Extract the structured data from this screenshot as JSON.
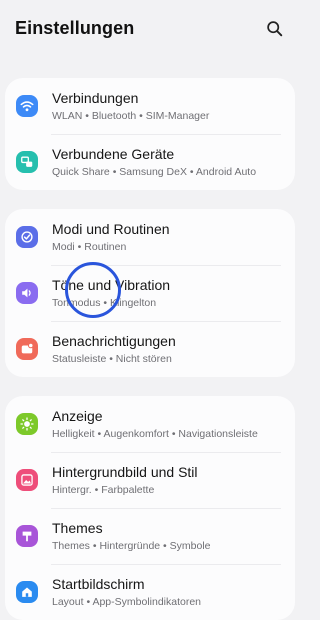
{
  "header": {
    "title": "Einstellungen",
    "search_icon": "search-icon"
  },
  "groups": [
    {
      "items": [
        {
          "title": "Verbindungen",
          "subtitle": "WLAN  •  Bluetooth  •  SIM-Manager",
          "icon": "wifi-icon",
          "color": "#3d8af7"
        },
        {
          "title": "Verbundene Geräte",
          "subtitle": "Quick Share  •  Samsung DeX  •  Android Auto",
          "icon": "connected-devices-icon",
          "color": "#26bfae"
        }
      ]
    },
    {
      "items": [
        {
          "title": "Modi und Routinen",
          "subtitle": "Modi  •  Routinen",
          "icon": "modes-icon",
          "color": "#5b6ee8"
        },
        {
          "title": "Töne und Vibration",
          "subtitle": "Tonmodus  •  Klingelton",
          "icon": "sound-icon",
          "color": "#8a6cf0"
        },
        {
          "title": "Benachrichtigungen",
          "subtitle": "Statusleiste  •  Nicht stören",
          "icon": "notifications-icon",
          "color": "#f06a5a"
        }
      ]
    },
    {
      "items": [
        {
          "title": "Anzeige",
          "subtitle": "Helligkeit  •  Augenkomfort  •  Navigationsleiste",
          "icon": "display-icon",
          "color": "#7dc92a"
        },
        {
          "title": "Hintergrundbild und Stil",
          "subtitle": "Hintergr.  •  Farbpalette",
          "icon": "wallpaper-icon",
          "color": "#ee4e7a"
        },
        {
          "title": "Themes",
          "subtitle": "Themes  •  Hintergründe  •  Symbole",
          "icon": "themes-icon",
          "color": "#a855d8"
        },
        {
          "title": "Startbildschirm",
          "subtitle": "Layout  •  App-Symbolindikatoren",
          "icon": "home-screen-icon",
          "color": "#2a8bf0"
        }
      ]
    }
  ]
}
